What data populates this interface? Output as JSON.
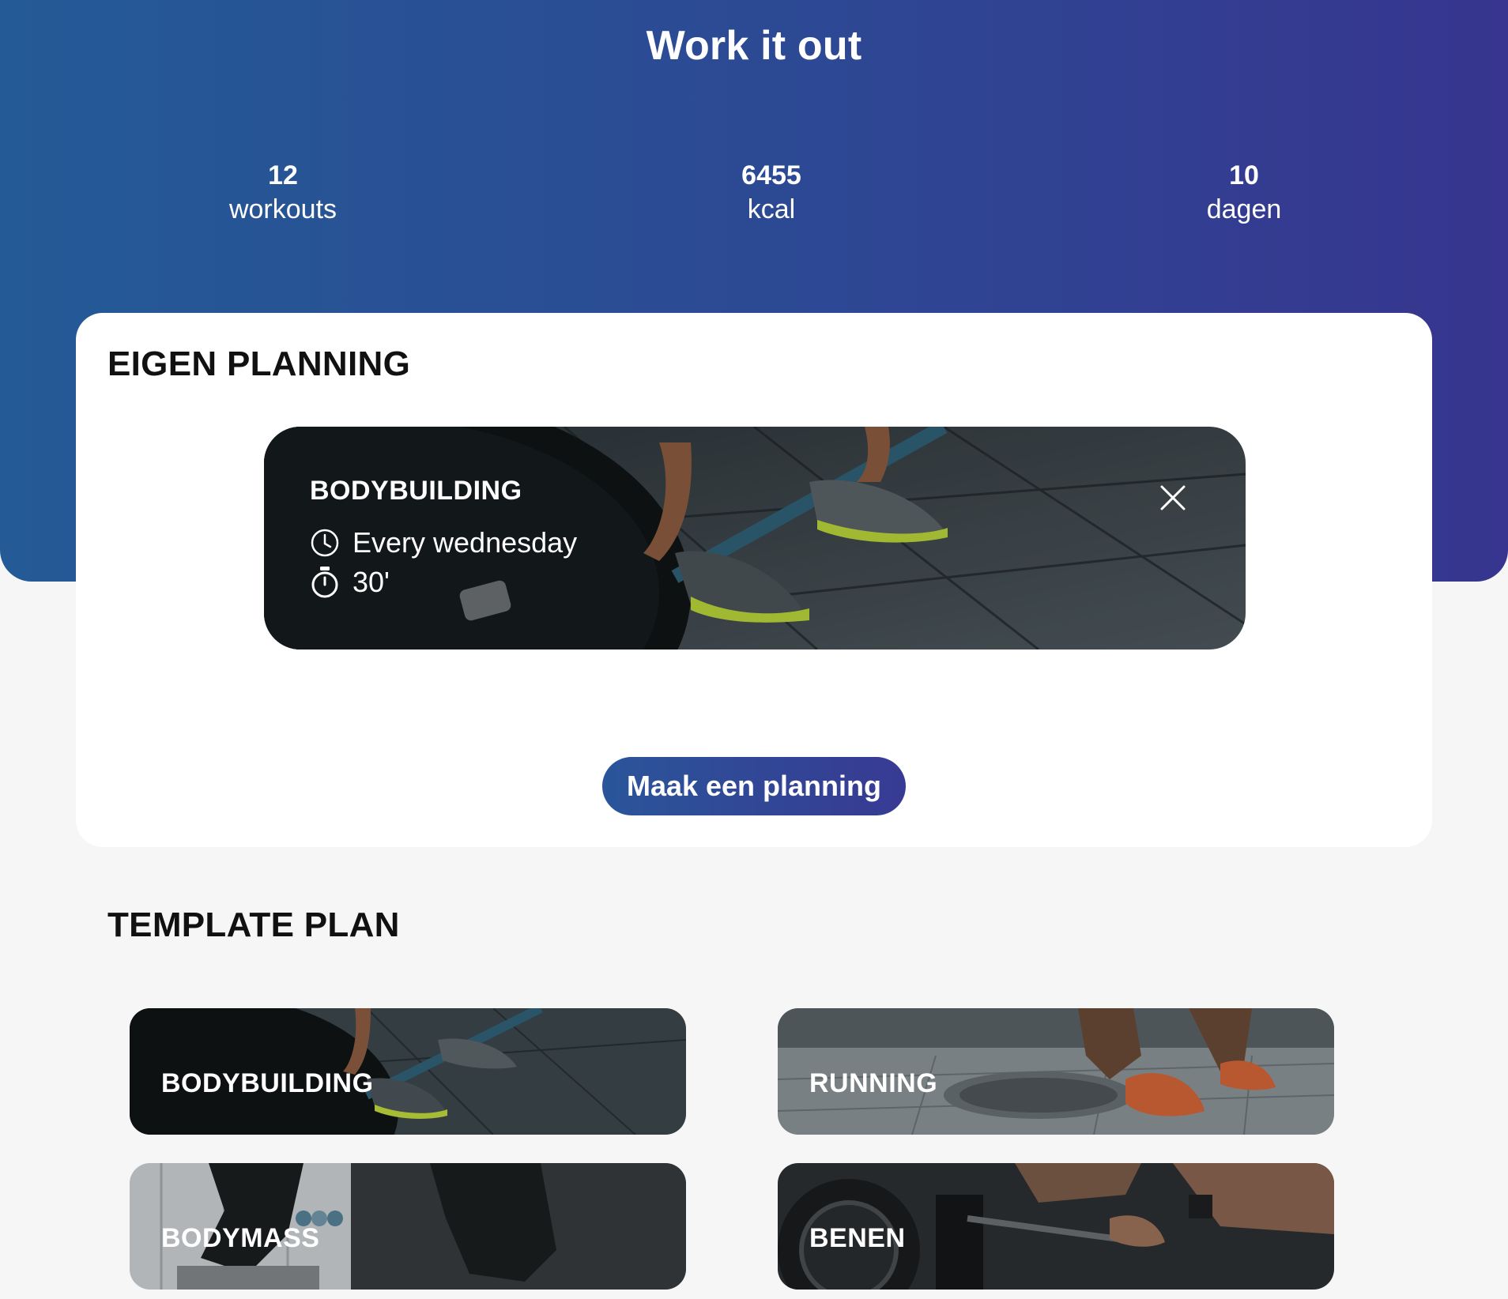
{
  "header": {
    "title": "Work it out",
    "stats": [
      {
        "value": "12",
        "label": "workouts"
      },
      {
        "value": "6455",
        "label": "kcal"
      },
      {
        "value": "10",
        "label": "dagen"
      }
    ]
  },
  "planning": {
    "title": "EIGEN PLANNING",
    "items": [
      {
        "name": "BODYBUILDING",
        "schedule": "Every wednesday",
        "duration": "30'"
      }
    ],
    "create_button": "Maak een planning"
  },
  "templates": {
    "title": "TEMPLATE PLAN",
    "items": [
      {
        "label": "BODYBUILDING"
      },
      {
        "label": "RUNNING"
      },
      {
        "label": "BODYMASS"
      },
      {
        "label": "BENEN"
      }
    ]
  },
  "colors": {
    "gradient_start": "#245a96",
    "gradient_end": "#37358f",
    "background": "#f6f6f6",
    "card": "#ffffff"
  },
  "icons": [
    "clock-icon",
    "stopwatch-icon",
    "close-icon"
  ]
}
